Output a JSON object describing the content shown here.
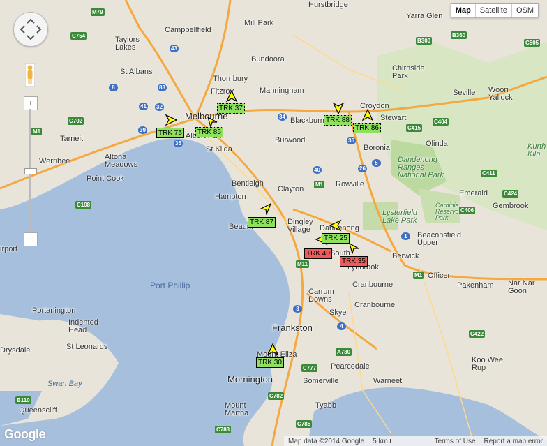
{
  "map_type": {
    "items": [
      "Map",
      "Satellite",
      "OSM"
    ],
    "selected": "Map"
  },
  "controls": {
    "zoom_in": "+",
    "zoom_out": "−"
  },
  "footer": {
    "attribution": "Map data ©2014 Google",
    "scale": "5 km",
    "terms": "Terms of Use",
    "report": "Report a map error"
  },
  "logo": "Google",
  "labels": {
    "hurstbridge": "Hurstbridge",
    "yarra_glen": "Yarra Glen",
    "campbellfield": "Campbellfield",
    "mill_park": "Mill Park",
    "taylors_lakes": "Taylors\nLakes",
    "bundoora": "Bundoora",
    "st_albans": "St Albans",
    "thornbury": "Thornbury",
    "chirnside_park": "Chirnside\nPark",
    "fitzroy": "Fitzroy",
    "manningham": "Manningham",
    "seville": "Seville",
    "woori_yallock": "Woori\nYallock",
    "croydon": "Croydon",
    "melbourne": "Melbourne",
    "blackburn": "Blackburn",
    "lilydale_stewart": "Stewart",
    "tarneit": "Tarneit",
    "albert_park": "Albert Park",
    "olinda": "Olinda",
    "altona_meadows": "Altona\nMeadows",
    "burwood": "Burwood",
    "boronia": "Boronia",
    "werribee": "Werribee",
    "st_kilda": "St Kilda",
    "dandenong_ranges": "Dandenong\nRanges\nNational Park",
    "point_cook": "Point Cook",
    "bentleigh": "Bentleigh",
    "clayton": "Clayton",
    "rowville": "Rowville",
    "emerald": "Emerald",
    "hampton": "Hampton",
    "lysterfield": "Lysterfield\nLake Park",
    "cardinia": "Cardinia\nReservoir\nPark",
    "gembrook": "Gembrook",
    "beaumaris": "Beaum",
    "dingley": "Dingley\nVillage",
    "dandenong": "Dandenong",
    "beaconsfield": "Beaconsfield\nUpper",
    "airport": "irport",
    "south": "South",
    "berwick": "Berwick",
    "lynbrook": "Lynbrook",
    "officer": "Officer",
    "port_phillip": "Port Phillip",
    "pakenham": "Pakenham",
    "nar_nar": "Nar Nar\nGoon",
    "cranbourne": "Cranbourne",
    "carrum_downs": "Carrum\nDowns",
    "portarlington": "Portarlington",
    "indented_head": "Indented\nHead",
    "skye": "Skye",
    "frankston": "Frankston",
    "st_leonards": "St Leonards",
    "drysdale": "Drysdale",
    "mount_eliza": "Mount Eliza",
    "pearcedale": "Pearcedale",
    "koo_wee_rup": "Koo Wee\nRup",
    "swan_bay": "Swan Bay",
    "mornington": "Mornington",
    "somerville": "Somerville",
    "warneet": "Warneet",
    "queenscliff": "Queenscliff",
    "tyabb": "Tyabb",
    "mount_martha": "Mount\nMartha",
    "kurth": "Kurth\nKiln"
  },
  "trucks": [
    {
      "id": "TRK 37",
      "status": "ok",
      "style": "dotted"
    },
    {
      "id": "TRK 88",
      "status": "ok",
      "style": "dotted"
    },
    {
      "id": "TRK 86",
      "status": "ok",
      "style": "dotted"
    },
    {
      "id": "TRK 75",
      "status": "ok",
      "style": "solid"
    },
    {
      "id": "TRK 85",
      "status": "ok",
      "style": "dotted"
    },
    {
      "id": "TRK 87",
      "status": "ok",
      "style": "solid"
    },
    {
      "id": "TRK 25",
      "status": "ok",
      "style": "solid"
    },
    {
      "id": "TRK 40",
      "status": "alert",
      "style": "solid"
    },
    {
      "id": "TRK 35",
      "status": "alert",
      "style": "solid"
    },
    {
      "id": "TRK 30",
      "status": "ok",
      "style": "solid"
    }
  ],
  "colors": {
    "water": "#a5bfdd",
    "land": "#e8e4da",
    "park": "#c9dfb0",
    "highway": "#f4a83e",
    "truck_ok": "#8ee05e",
    "truck_alert": "#ef5a5a"
  }
}
